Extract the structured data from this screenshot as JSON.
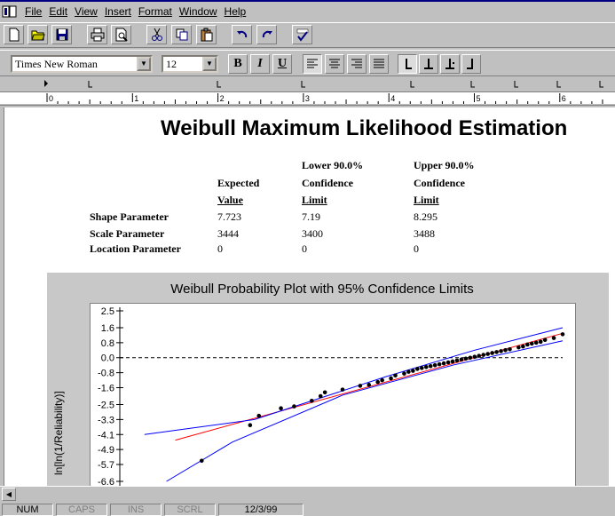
{
  "menu": [
    "File",
    "Edit",
    "View",
    "Insert",
    "Format",
    "Window",
    "Help"
  ],
  "format": {
    "font": "Times New Roman",
    "size": "12",
    "bold": "B",
    "italic": "I",
    "underline": "U"
  },
  "ruler": {
    "numbers": [
      "0",
      "1",
      "2",
      "3",
      "4",
      "5",
      "6"
    ]
  },
  "doc": {
    "title": "Weibull Maximum Likelihood Estimation",
    "headers": {
      "expected": [
        "Expected",
        "Value"
      ],
      "lower": [
        "Lower 90.0%",
        "Confidence",
        "Limit"
      ],
      "upper": [
        "Upper 90.0%",
        "Confidence",
        "Limit"
      ]
    },
    "rows": [
      {
        "label": "Shape Parameter",
        "expected": "7.723",
        "lower": "7.19",
        "upper": "8.295"
      },
      {
        "label": "Scale Parameter",
        "expected": "3444",
        "lower": "3400",
        "upper": "3488"
      },
      {
        "label": "Location Parameter",
        "expected": "0",
        "lower": "0",
        "upper": "0"
      }
    ]
  },
  "chart_data": {
    "type": "scatter",
    "title": "Weibull Probability Plot with 95% Confidence Limits",
    "ylabel": "ln[ln(1/Reliability)]",
    "xlabel": "",
    "y_ticks": [
      "2.5",
      "1.6",
      "0.8",
      "0.0",
      "-0.8",
      "-1.6",
      "-2.5",
      "-3.3",
      "-4.1",
      "-4.9",
      "-5.7",
      "-6.6"
    ],
    "ylim": [
      -6.6,
      2.5
    ],
    "xlim": [
      0,
      1
    ],
    "reference_line_y": 0.0,
    "points": {
      "x": [
        0.18,
        0.29,
        0.31,
        0.36,
        0.39,
        0.43,
        0.45,
        0.46,
        0.5,
        0.54,
        0.56,
        0.58,
        0.59,
        0.61,
        0.62,
        0.64,
        0.65,
        0.66,
        0.67,
        0.68,
        0.69,
        0.7,
        0.71,
        0.72,
        0.73,
        0.74,
        0.75,
        0.76,
        0.77,
        0.78,
        0.79,
        0.8,
        0.81,
        0.82,
        0.83,
        0.84,
        0.85,
        0.86,
        0.87,
        0.88,
        0.9,
        0.91,
        0.92,
        0.93,
        0.94,
        0.95,
        0.96,
        0.98,
        1.0
      ],
      "y": [
        -5.5,
        -3.6,
        -3.1,
        -2.7,
        -2.6,
        -2.3,
        -2.05,
        -1.85,
        -1.7,
        -1.5,
        -1.45,
        -1.3,
        -1.2,
        -1.1,
        -0.95,
        -0.85,
        -0.75,
        -0.7,
        -0.6,
        -0.55,
        -0.5,
        -0.45,
        -0.4,
        -0.35,
        -0.3,
        -0.25,
        -0.2,
        -0.15,
        -0.1,
        -0.05,
        0.0,
        0.05,
        0.1,
        0.15,
        0.2,
        0.25,
        0.3,
        0.35,
        0.4,
        0.45,
        0.55,
        0.6,
        0.7,
        0.75,
        0.8,
        0.85,
        0.95,
        1.05,
        1.25
      ]
    },
    "series": [
      {
        "color": "#ff0000",
        "x": [
          0.12,
          1.0
        ],
        "y": [
          -4.4,
          1.3
        ]
      },
      {
        "color": "#0000ff",
        "x": [
          0.05,
          0.3,
          0.6,
          0.8,
          1.0
        ],
        "y": [
          -4.1,
          -3.3,
          -1.0,
          0.4,
          1.6
        ]
      },
      {
        "color": "#0000ff",
        "x": [
          0.1,
          0.25,
          0.5,
          0.75,
          1.0
        ],
        "y": [
          -6.6,
          -4.5,
          -2.0,
          -0.4,
          0.9
        ]
      }
    ]
  },
  "status": [
    "NUM",
    "CAPS",
    "INS",
    "SCRL",
    "12/3/99"
  ]
}
